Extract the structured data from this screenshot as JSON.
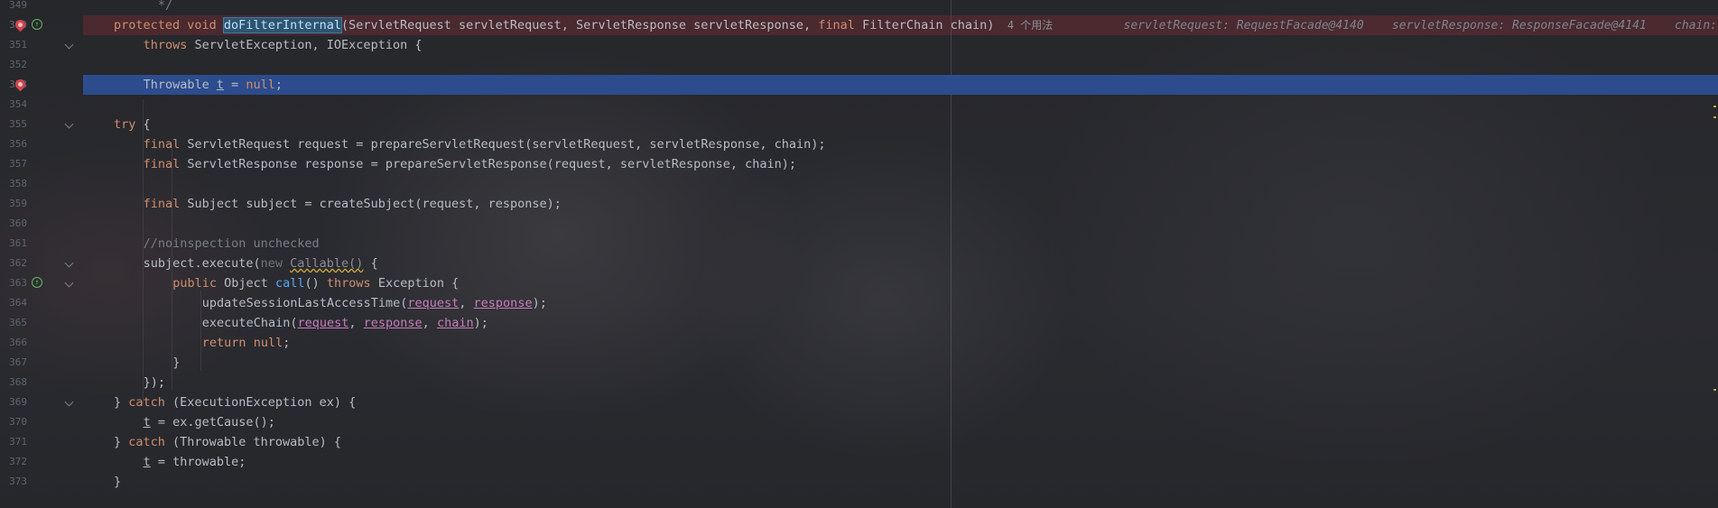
{
  "editor": {
    "lines": [
      {
        "num": "349",
        "tokens": [
          {
            "t": "*/",
            "c": "cm",
            "indent": 1
          }
        ]
      },
      {
        "num": "350",
        "bp": true,
        "override": true,
        "error": true,
        "tokens": [
          {
            "t": "protected ",
            "c": "kw"
          },
          {
            "t": "void ",
            "c": "kw"
          },
          {
            "t": "doFilterInternal",
            "c": "sel"
          },
          {
            "t": "(ServletRequest servletRequest, ServletResponse servletResponse, ",
            "c": "m"
          },
          {
            "t": "final ",
            "c": "kw"
          },
          {
            "t": "FilterChain chain)",
            "c": "m"
          }
        ],
        "hint": "4 个用法",
        "inlays": [
          "servletRequest: RequestFacade@4140",
          "servletResponse: ResponseFacade@4141",
          "chain: Ap"
        ]
      },
      {
        "num": "351",
        "fold": true,
        "tokens": [
          {
            "t": "throws ",
            "c": "kw",
            "indent": 4
          },
          {
            "t": "ServletException, IOException {",
            "c": "m"
          }
        ]
      },
      {
        "num": "352",
        "tokens": []
      },
      {
        "num": "353",
        "bp": true,
        "exec": true,
        "tokens": [
          {
            "t": "Throwable ",
            "c": "m",
            "indent": 1
          },
          {
            "t": "t",
            "c": "un"
          },
          {
            "t": " = ",
            "c": "m"
          },
          {
            "t": "null",
            "c": "kw"
          },
          {
            "t": ";",
            "c": "m"
          }
        ]
      },
      {
        "num": "354",
        "tokens": []
      },
      {
        "num": "355",
        "fold": true,
        "tokens": [
          {
            "t": "try ",
            "c": "kw",
            "indent": 2
          },
          {
            "t": "{",
            "c": "m"
          }
        ]
      },
      {
        "num": "356",
        "tokens": [
          {
            "t": "final ",
            "c": "kw",
            "indent": 4
          },
          {
            "t": "ServletRequest request = prepareServletRequest(servletRequest, servletResponse, chain);",
            "c": "m"
          }
        ]
      },
      {
        "num": "357",
        "tokens": [
          {
            "t": "final ",
            "c": "kw",
            "indent": 4
          },
          {
            "t": "ServletResponse response = prepareServletResponse(request, servletResponse, chain);",
            "c": "m"
          }
        ]
      },
      {
        "num": "358",
        "tokens": []
      },
      {
        "num": "359",
        "tokens": [
          {
            "t": "final ",
            "c": "kw",
            "indent": 4
          },
          {
            "t": "Subject subject = createSubject(request, response);",
            "c": "m"
          }
        ]
      },
      {
        "num": "360",
        "tokens": []
      },
      {
        "num": "361",
        "tokens": [
          {
            "t": "//noinspection unchecked",
            "c": "cm",
            "indent": 4
          }
        ]
      },
      {
        "num": "362",
        "fold": true,
        "tokens": [
          {
            "t": "subject.execute(",
            "c": "m",
            "indent": 4
          },
          {
            "t": "new ",
            "c": "gray"
          },
          {
            "t": "Callable()",
            "c": "wavy"
          },
          {
            "t": " {",
            "c": "m"
          }
        ]
      },
      {
        "num": "363",
        "override": true,
        "fold": true,
        "tokens": [
          {
            "t": "public ",
            "c": "kw",
            "indent": 6
          },
          {
            "t": "Object ",
            "c": "m"
          },
          {
            "t": "call",
            "c": "fn"
          },
          {
            "t": "() ",
            "c": "m"
          },
          {
            "t": "throws ",
            "c": "kw"
          },
          {
            "t": "Exception {",
            "c": "m"
          }
        ]
      },
      {
        "num": "364",
        "tokens": [
          {
            "t": "updateSessionLastAccessTime(",
            "c": "m",
            "indent": 8
          },
          {
            "t": "request",
            "c": "pv"
          },
          {
            "t": ", ",
            "c": "m"
          },
          {
            "t": "response",
            "c": "pv"
          },
          {
            "t": ");",
            "c": "m"
          }
        ]
      },
      {
        "num": "365",
        "tokens": [
          {
            "t": "executeChain(",
            "c": "m",
            "indent": 8
          },
          {
            "t": "request",
            "c": "pv"
          },
          {
            "t": ", ",
            "c": "m"
          },
          {
            "t": "response",
            "c": "pv"
          },
          {
            "t": ", ",
            "c": "m"
          },
          {
            "t": "chain",
            "c": "pv"
          },
          {
            "t": ");",
            "c": "m"
          }
        ]
      },
      {
        "num": "366",
        "tokens": [
          {
            "t": "return ",
            "c": "kw",
            "indent": 8
          },
          {
            "t": "null",
            "c": "kw"
          },
          {
            "t": ";",
            "c": "m"
          }
        ]
      },
      {
        "num": "367",
        "tokens": [
          {
            "t": "}",
            "c": "m",
            "indent": 6
          }
        ]
      },
      {
        "num": "368",
        "tokens": [
          {
            "t": "});",
            "c": "m",
            "indent": 4
          }
        ]
      },
      {
        "num": "369",
        "fold": true,
        "tokens": [
          {
            "t": "} ",
            "c": "m",
            "indent": 2
          },
          {
            "t": "catch ",
            "c": "kw"
          },
          {
            "t": "(ExecutionException ex) {",
            "c": "m"
          }
        ]
      },
      {
        "num": "370",
        "tokens": [
          {
            "t": "t",
            "c": "un",
            "indent": 4
          },
          {
            "t": " = ex.getCause();",
            "c": "m"
          }
        ]
      },
      {
        "num": "371",
        "tokens": [
          {
            "t": "} ",
            "c": "m",
            "indent": 2
          },
          {
            "t": "catch ",
            "c": "kw"
          },
          {
            "t": "(Throwable throwable) {",
            "c": "m"
          }
        ]
      },
      {
        "num": "372",
        "tokens": [
          {
            "t": "t",
            "c": "un",
            "indent": 4
          },
          {
            "t": " = throwable;",
            "c": "m"
          }
        ]
      },
      {
        "num": "373",
        "tokens": [
          {
            "t": "}",
            "c": "m",
            "indent": 2
          }
        ]
      }
    ]
  }
}
